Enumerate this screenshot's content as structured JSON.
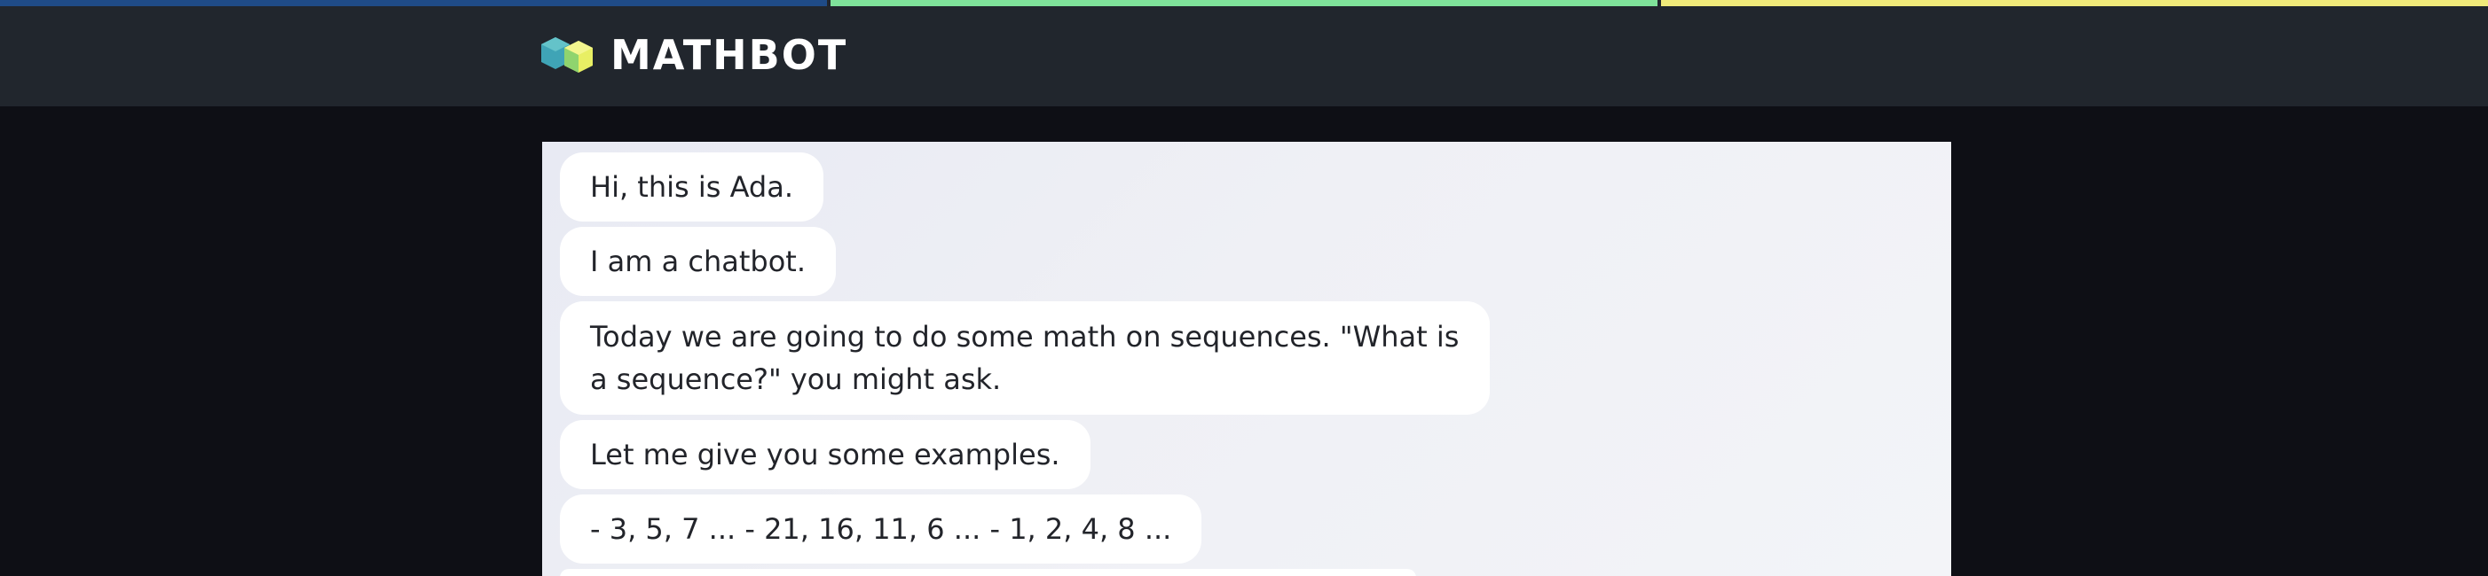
{
  "app": {
    "title": "MATHBOT",
    "logo_icon": "hexagon-cube-logo",
    "stripe_colors": [
      "#1f4b87",
      "#7fe29a",
      "#f0ea7a"
    ],
    "header_bg": "#21262d",
    "page_bg": "#0e0f15"
  },
  "chat": {
    "messages": [
      {
        "text": "Hi, this is Ada."
      },
      {
        "text": "I am a chatbot."
      },
      {
        "text": "Today we are going to do some math on sequences. \"What is a sequence?\" you might ask."
      },
      {
        "text": "Let me give you some examples."
      },
      {
        "text": "- 3, 5, 7 ... - 21, 16, 11, 6 ... - 1, 2, 4, 8 ..."
      }
    ]
  }
}
